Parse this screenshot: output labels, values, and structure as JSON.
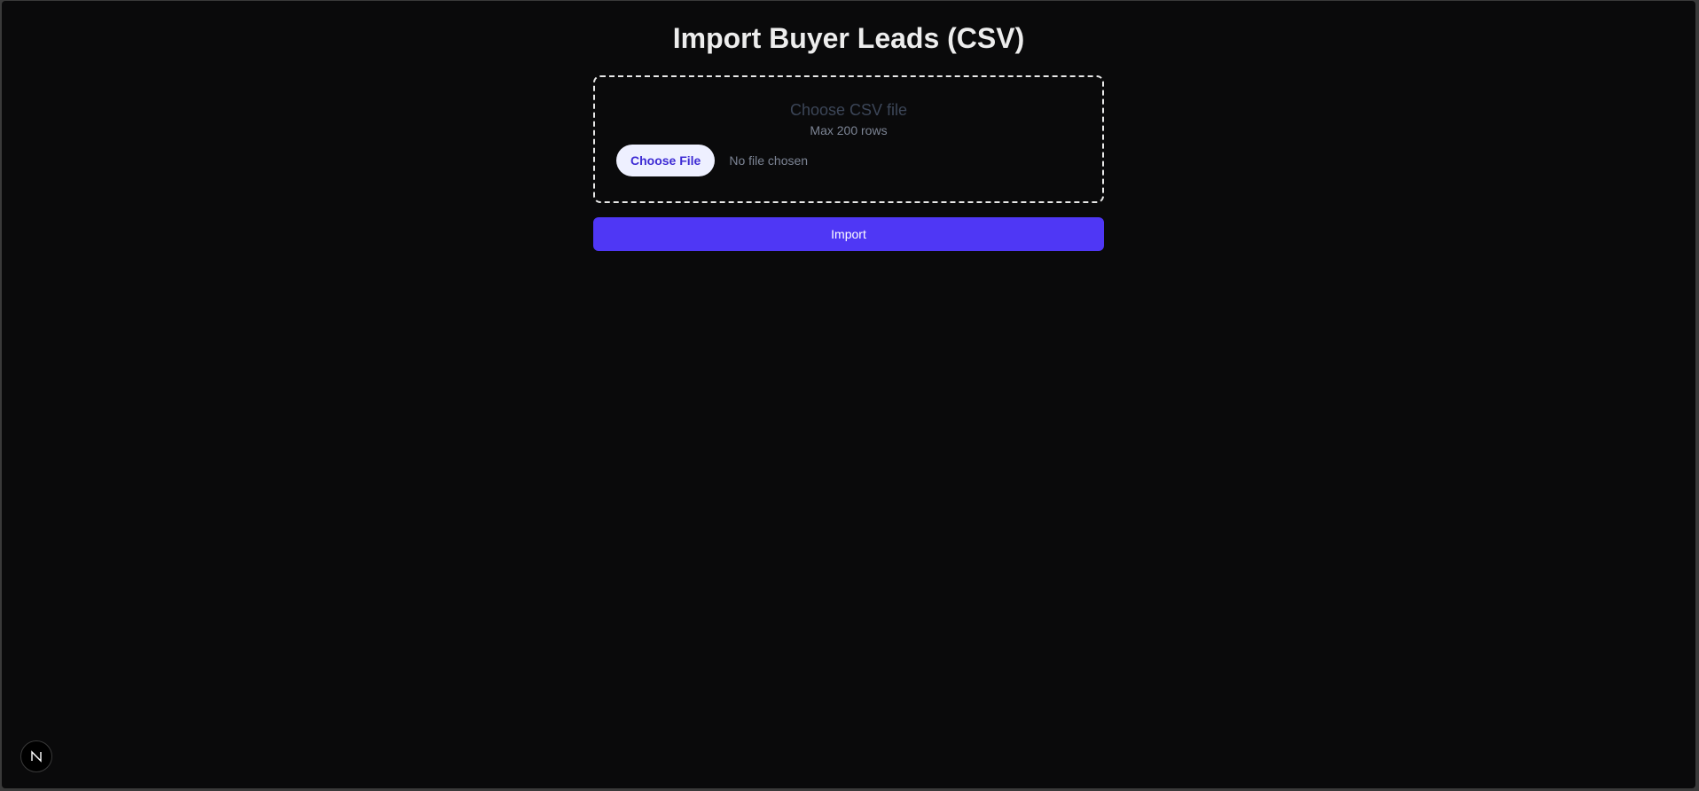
{
  "page": {
    "title": "Import Buyer Leads (CSV)"
  },
  "upload": {
    "heading": "Choose CSV file",
    "hint": "Max 200 rows",
    "choose_button": "Choose File",
    "file_status": "No file chosen"
  },
  "actions": {
    "import_label": "Import"
  },
  "dev_badge": {
    "icon": "nextjs-logo-icon"
  },
  "colors": {
    "background": "#0a0a0b",
    "accent": "#4f37f5",
    "choose_button_bg": "#eef0ff",
    "choose_button_text": "#3d2bd4"
  }
}
